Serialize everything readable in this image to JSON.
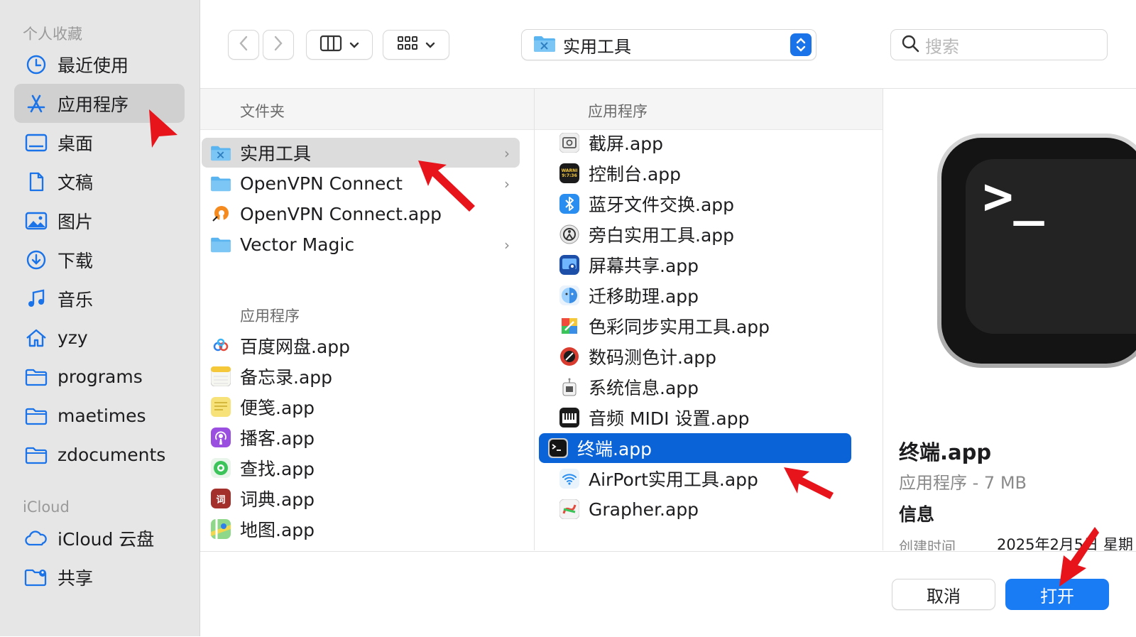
{
  "sidebar": {
    "favorites_label": "个人收藏",
    "items": [
      {
        "label": "最近使用",
        "icon": "clock-icon"
      },
      {
        "label": "应用程序",
        "icon": "applications-icon"
      },
      {
        "label": "桌面",
        "icon": "desktop-icon"
      },
      {
        "label": "文稿",
        "icon": "document-icon"
      },
      {
        "label": "图片",
        "icon": "photo-icon"
      },
      {
        "label": "下载",
        "icon": "download-icon"
      },
      {
        "label": "音乐",
        "icon": "music-icon"
      },
      {
        "label": "yzy",
        "icon": "home-icon"
      },
      {
        "label": "programs",
        "icon": "folder-icon"
      },
      {
        "label": "maetimes",
        "icon": "folder-icon"
      },
      {
        "label": "zdocuments",
        "icon": "folder-icon"
      }
    ],
    "icloud_label": "iCloud",
    "icloud_items": [
      {
        "label": "iCloud 云盘",
        "icon": "cloud-icon"
      },
      {
        "label": "共享",
        "icon": "shared-folder-icon"
      }
    ],
    "selected": "应用程序"
  },
  "toolbar": {
    "view_column_icon": "columns-icon",
    "view_grid_icon": "grid-icon",
    "path_label": "实用工具",
    "search_placeholder": "搜索"
  },
  "column1": {
    "header": "文件夹",
    "folders": [
      {
        "label": "实用工具",
        "has_children": true,
        "selected": true
      },
      {
        "label": "OpenVPN Connect",
        "has_children": true
      },
      {
        "label": "OpenVPN Connect.app",
        "has_children": false
      },
      {
        "label": "Vector Magic",
        "has_children": true
      }
    ],
    "apps_label": "应用程序",
    "apps": [
      "百度网盘.app",
      "备忘录.app",
      "便笺.app",
      "播客.app",
      "查找.app",
      "词典.app",
      "地图.app"
    ]
  },
  "column2": {
    "header": "应用程序",
    "apps": [
      "截屏.app",
      "控制台.app",
      "蓝牙文件交换.app",
      "旁白实用工具.app",
      "屏幕共享.app",
      "迁移助理.app",
      "色彩同步实用工具.app",
      "数码测色计.app",
      "系统信息.app",
      "音频 MIDI 设置.app",
      "终端.app",
      "AirPort实用工具.app",
      "Grapher.app"
    ],
    "selected": "终端.app",
    "console_icon_text": "WARNI\n9:7:36",
    "dictionary_icon_text": "词"
  },
  "preview": {
    "icon_prompt": ">_",
    "name": "终端.app",
    "kind": "应用程序 - 7 MB",
    "info_heading": "信息",
    "created_label": "创建时间",
    "created_value": "2025年2月5日 星期"
  },
  "buttons": {
    "cancel": "取消",
    "open": "打开"
  },
  "colors": {
    "accent": "#1a7cf5",
    "selection_blue": "#0a64d8",
    "annotation_red": "#e8141c"
  }
}
